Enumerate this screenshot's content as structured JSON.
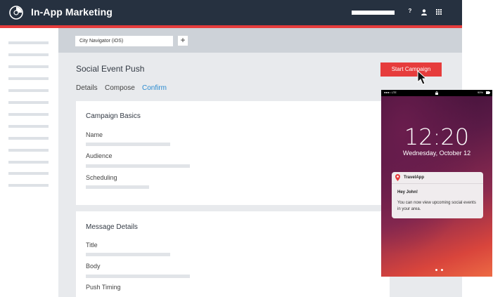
{
  "header": {
    "title": "In-App Marketing",
    "help_label": "?"
  },
  "toolbar": {
    "app_selector_value": "City Navigator (iOS)",
    "add_label": "+"
  },
  "campaign": {
    "title": "Social Event Push",
    "start_label": "Start Campaign",
    "tabs": [
      {
        "label": "Details",
        "active": false
      },
      {
        "label": "Compose",
        "active": false
      },
      {
        "label": "Confirm",
        "active": true
      }
    ]
  },
  "basics": {
    "title": "Campaign Basics",
    "fields": [
      "Name",
      "Audience",
      "Scheduling"
    ]
  },
  "message": {
    "title": "Message Details",
    "fields": [
      "Title",
      "Body",
      "Push Timing"
    ]
  },
  "phone": {
    "status_carrier": "●●●○ LTE",
    "status_battery": "90%",
    "time": "12:20",
    "date": "Wednesday, October 12",
    "notification": {
      "app": "TravelApp",
      "title": "Hey John!",
      "body": "You can now view upcoming social events in your area."
    }
  },
  "colors": {
    "header_bg": "#263140",
    "accent_red": "#e63c3c",
    "link_blue": "#2a8bd0",
    "content_bg": "#e8eaed"
  }
}
